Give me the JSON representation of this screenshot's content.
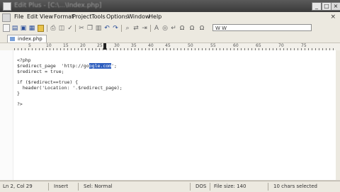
{
  "window": {
    "title": "Edit Plus - [C:\\...\\Index.php]"
  },
  "menu": [
    "File",
    "Edit",
    "View",
    "Format",
    "Project",
    "Tools",
    "Options",
    "Window",
    "Help"
  ],
  "toolbar": {
    "combo_value": "W W"
  },
  "tabs": [
    {
      "label": "index.php"
    }
  ],
  "ruler": {
    "marks": [
      "5",
      "10",
      "15",
      "20",
      "25",
      "30",
      "35",
      "40",
      "45",
      "50",
      "55",
      "60",
      "65",
      "70",
      "75"
    ]
  },
  "editor": {
    "lines": [
      "<?php",
      "$redirect_page  'http://go",
      "$redirect = true;",
      "",
      "if ($redirect==true) {",
      "  header('Location: '.$redirect_page);",
      "}",
      "",
      "?>"
    ],
    "selected_text": "ogle.com",
    "after_selection": "';"
  },
  "status": {
    "position": "Ln 2, Col 29",
    "mode": "Insert",
    "syntax": "Sel: Normal",
    "eol": "DOS",
    "file_size": "File size: 140",
    "selection": "10 chars selected"
  }
}
